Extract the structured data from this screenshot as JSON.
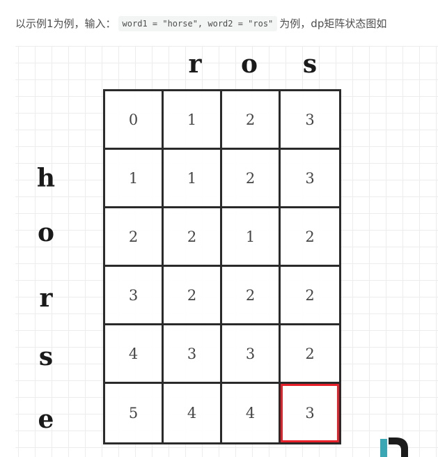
{
  "intro": {
    "prefix": "以示例1为例，输入：",
    "code": "word1 = \"horse\", word2 = \"ros\"",
    "suffix": "为例，dp矩阵状态图如"
  },
  "dp_table": {
    "column_headers": [
      "r",
      "o",
      "s"
    ],
    "row_headers": [
      "h",
      "o",
      "r",
      "s",
      "e"
    ],
    "rows": [
      [
        "0",
        "1",
        "2",
        "3"
      ],
      [
        "1",
        "1",
        "2",
        "3"
      ],
      [
        "2",
        "2",
        "1",
        "2"
      ],
      [
        "3",
        "2",
        "2",
        "2"
      ],
      [
        "4",
        "3",
        "3",
        "2"
      ],
      [
        "5",
        "4",
        "4",
        "3"
      ]
    ],
    "highlight_cell": {
      "row": 5,
      "col": 3
    },
    "highlight_color": "#e8202a",
    "line_color": "#2a2a2a"
  },
  "watermark": {
    "colors": [
      "#3aa8b4",
      "#1c1c1c"
    ]
  }
}
